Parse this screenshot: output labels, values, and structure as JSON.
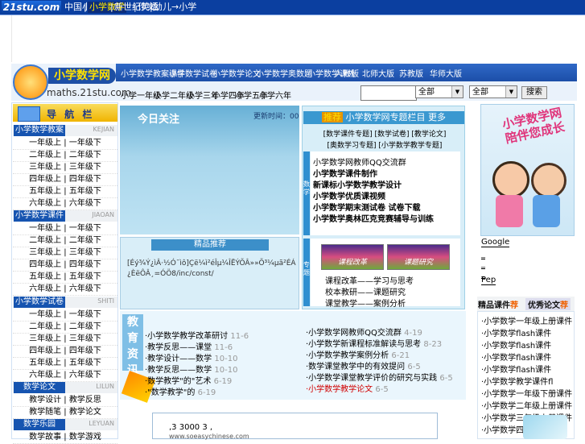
{
  "top_nav": {
    "logo": "21stu.com",
    "links": [
      "中国小学网",
      "小学数学",
      "新世纪英语",
      "作文",
      "幼儿→小学"
    ],
    "active_index": 1
  },
  "header": {
    "brand_name": "小学数学网",
    "brand_url": "maths.21stu.com",
    "main_links": [
      "小学数学教案课件",
      "小学数学试卷",
      "小学数学论文",
      "小学数学奥数题",
      "小学数学课外"
    ],
    "right_links": [
      "人教版",
      "北师大版",
      "苏教版",
      "华师大版"
    ],
    "sub_links": [
      "小学一年级",
      "小学二年级",
      "小学三年",
      "小学四年",
      "小学五年",
      "小学六年"
    ],
    "search_placeholder": "",
    "select1": "全部",
    "select2": "全部",
    "search_button": "搜索"
  },
  "left_nav": {
    "title": "导 航 栏",
    "sections": [
      {
        "name": "小学数学教案",
        "en": "KEJIAN",
        "rows": [
          "一年级上 | 一年级下",
          "二年级上 | 二年级下",
          "三年级上 | 三年级下",
          "四年级上 | 四年级下",
          "五年级上 | 五年级下",
          "六年级上 | 六年级下"
        ]
      },
      {
        "name": "小学数学课件",
        "en": "JIAOAN",
        "rows": [
          "一年级上 | 一年级下",
          "二年级上 | 二年级下",
          "三年级上 | 三年级下",
          "四年级上 | 四年级下",
          "五年级上 | 五年级下",
          "六年级上 | 六年级下"
        ]
      },
      {
        "name": "小学数学试卷",
        "en": "SHITI",
        "rows": [
          "一年级上 | 一年级下",
          "二年级上 | 二年级下",
          "三年级上 | 三年级下",
          "四年级上 | 四年级下",
          "五年级上 | 五年级下",
          "六年级上 | 六年级下"
        ]
      },
      {
        "name": "数学论文",
        "en": "LILUN",
        "rows": [
          "教学设计 | 教学反思",
          "教学随笔 | 教学论文"
        ]
      },
      {
        "name": "数学乐园",
        "en": "LEYUAN",
        "rows": [
          "数学故事 | 数学游戏"
        ]
      }
    ]
  },
  "today": {
    "title": "今日关注",
    "time_label": "更新时间：00"
  },
  "recommend": {
    "title": "精品推荐",
    "body": "[Éý¾Ý¿ìÂ·½Ó¯ìô]Çë¼ì²éÎµ¼ÎËÝÕÂ»»Õ³¼µã²ÉÁ¿ÈëÔÂ¸=ÓÖ8/inc/const/"
  },
  "right_panel": {
    "title_tag": "推荐",
    "title": "小学数学网专题栏目 更多",
    "links_row1": "[数学课件专题] [数学试卷] [教学论文]",
    "links_row2": "[奥数学习专题] [小学数学教学专题]",
    "side1": "数学",
    "items": [
      "小学数学网教师QQ交流群",
      "小学数学课件制作",
      "新课标小学数学教学设计",
      "小学数学优质课视频",
      "小学数学期末测试卷 试卷下载",
      "小学数学奥林匹克竞赛辅导与训练"
    ],
    "side2": "专题",
    "thumb1": "课程改革",
    "thumb2": "课题研究",
    "sub_items": [
      "课程改革——学习与思考",
      "校本教研——课题研究",
      "课堂教学——案例分析"
    ]
  },
  "edu_news": {
    "badge": "教育资讯",
    "left": [
      {
        "text": "·小学数学教学改革研讨",
        "date": "11-6"
      },
      {
        "text": "·教学反思——课堂",
        "date": "11-6"
      },
      {
        "text": "·教学设计——数学",
        "date": "10-10"
      },
      {
        "text": "·教学反思——数学",
        "date": "10-10"
      },
      {
        "text": "·数学教学\"的\"艺术",
        "date": "6-19"
      },
      {
        "text": "·\"数学教学\"的",
        "date": "6-19"
      }
    ],
    "right": [
      {
        "text": "·小学数学网教师QQ交流群",
        "date": "4-19",
        "red": false
      },
      {
        "text": "·小学数学新课程标准解读与思考",
        "date": "8-23",
        "red": false
      },
      {
        "text": "·小学数学教学案例分析",
        "date": "6-21",
        "red": false
      },
      {
        "text": "·数学课堂教学中的有效提问",
        "date": "6-5",
        "red": false
      },
      {
        "text": "·小学数学课堂教学评价的研究与实践",
        "date": "6-5",
        "red": false
      },
      {
        "text": "·小学数学教学论文",
        "date": "6-5",
        "red": true
      }
    ]
  },
  "bottom_box": {
    "number_line": ",3    3000  3    ,",
    "url": "www.soeasychinese.com"
  },
  "right_col": {
    "banner_text": "小学数学网 陪伴您成长",
    "links": [
      "Google",
      "_",
      "_",
      "_",
      "Pep"
    ],
    "tab1": "精品课件",
    "tab1_tag": "荐",
    "tab2": "优秀论文",
    "tab2_tag": "荐",
    "items": [
      "·小学数学一年级上册课件",
      "·小学数学flash课件",
      "·小学数学flash课件",
      "·小学数学flash课件",
      "·小学数学flash课件",
      "·小学数学教学课件fl",
      "·小学数学一年级下册课件",
      "·小学数学二年级上册课件",
      "·小学数学三年级上册课件",
      "·小学数学四年级课件"
    ]
  }
}
